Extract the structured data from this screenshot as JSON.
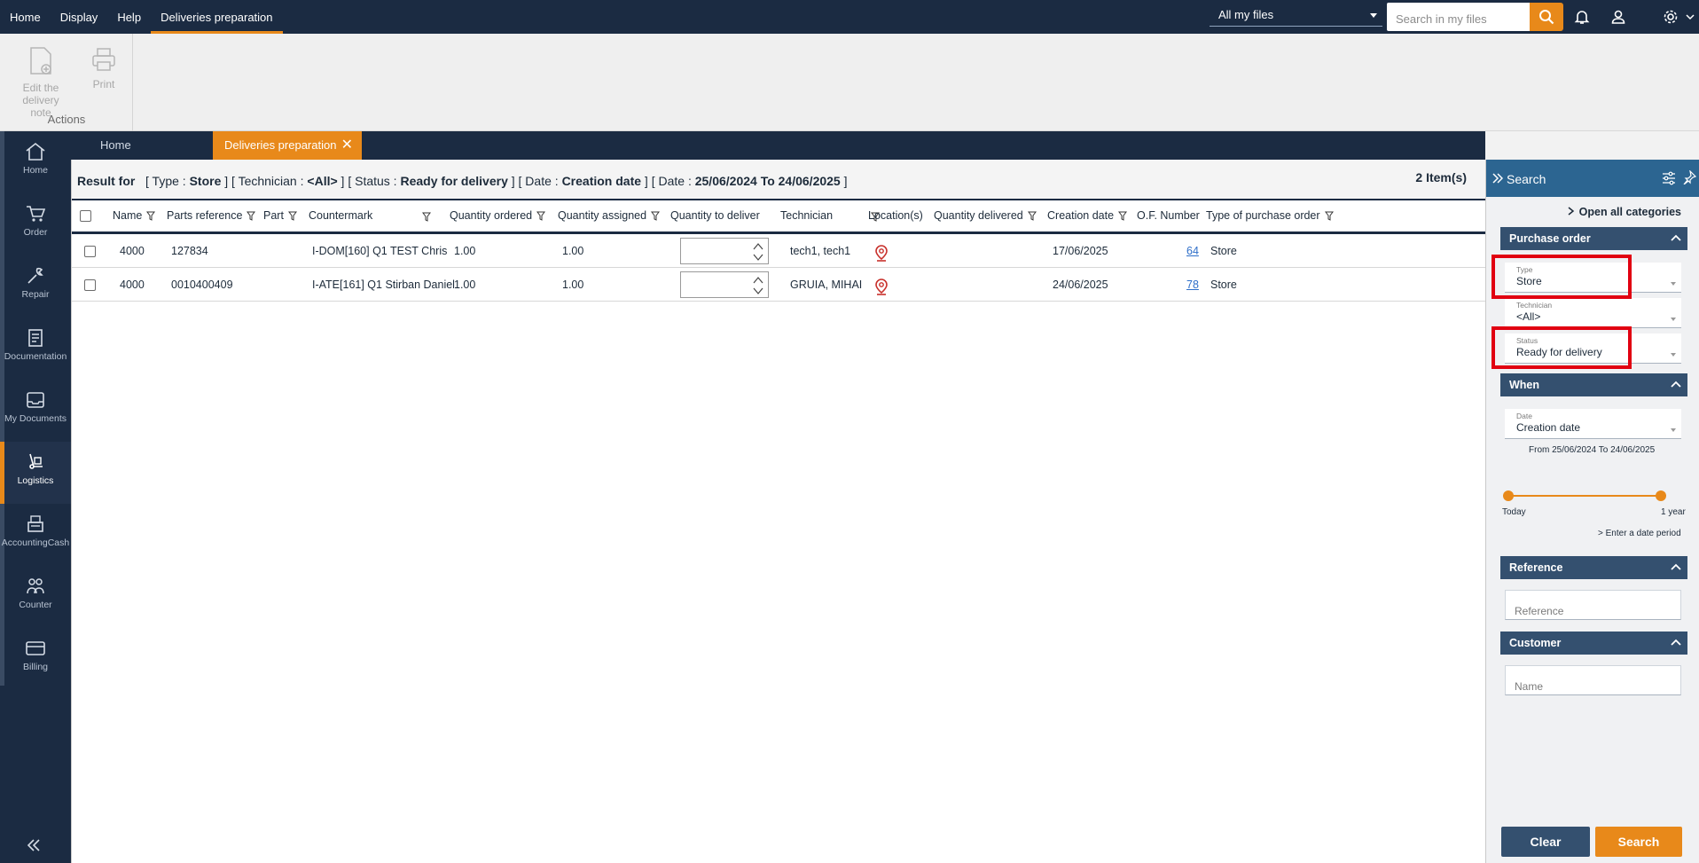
{
  "topbar": {
    "menu": [
      "Home",
      "Display",
      "Help",
      "Deliveries preparation"
    ],
    "scope": "All my files",
    "search_placeholder": "Search in my files"
  },
  "ribbon": {
    "edit_delivery_note": "Edit the delivery note",
    "print": "Print",
    "group_label": "Actions"
  },
  "leftnav": {
    "items": [
      "Home",
      "Order",
      "Repair",
      "Documentation",
      "My Documents",
      "Logistics",
      "AccountingCash",
      "Counter",
      "Billing"
    ],
    "active": "Logistics"
  },
  "tabs": {
    "home": "Home",
    "active": "Deliveries preparation"
  },
  "result": {
    "prefix": "Result for",
    "type_label": "[ Type :",
    "type_value": "Store",
    "technician_label": "]   [ Technician :",
    "technician_value": "<All>",
    "status_label": "]   [ Status :",
    "status_value": "Ready for delivery",
    "date_label": "]   [ Date :",
    "date_value": "Creation date",
    "range_label": "]   [ Date :",
    "range_value": "25/06/2024 To 24/06/2025",
    "suffix": "]",
    "count": "2 Item(s)"
  },
  "table": {
    "columns": [
      "Name",
      "Parts reference",
      "Part",
      "Countermark",
      "Quantity ordered",
      "Quantity assigned",
      "Quantity to deliver",
      "Technician",
      "Location(s)",
      "Quantity delivered",
      "Creation date",
      "O.F. Number",
      "Type of purchase order"
    ],
    "rows": [
      {
        "name": "4000",
        "parts_reference": "127834",
        "countermark": "I-DOM[160] Q1 TEST Chris",
        "qty_ordered": "1.00",
        "qty_assigned": "1.00",
        "technician": "tech1, tech1",
        "creation_date": "17/06/2025",
        "of_number": "64",
        "type": "Store"
      },
      {
        "name": "4000",
        "parts_reference": "0010400409",
        "countermark": "I-ATE[161] Q1 Stirban Daniel",
        "qty_ordered": "1.00",
        "qty_assigned": "1.00",
        "technician": "GRUIA, MIHAI",
        "creation_date": "24/06/2025",
        "of_number": "78",
        "type": "Store"
      }
    ]
  },
  "search_panel": {
    "title": "Search",
    "open_all": "Open all categories",
    "purchase_order": "Purchase order",
    "type_label": "Type",
    "type_value": "Store",
    "technician_label": "Technician",
    "technician_value": "<All>",
    "status_label": "Status",
    "status_value": "Ready for delivery",
    "when": "When",
    "date_label": "Date",
    "date_value": "Creation date",
    "range_text": "From 25/06/2024 To 24/06/2025",
    "slider_min": "Today",
    "slider_max": "1 year",
    "enter_period": "> Enter a date period",
    "reference": "Reference",
    "reference_placeholder": "Reference",
    "customer": "Customer",
    "name_placeholder": "Name",
    "clear": "Clear",
    "search": "Search"
  },
  "colors": {
    "navy": "#1b2b42",
    "accent": "#e8891a",
    "panel_head": "#2c6591",
    "section": "#34506f",
    "highlight": "#e10011"
  }
}
